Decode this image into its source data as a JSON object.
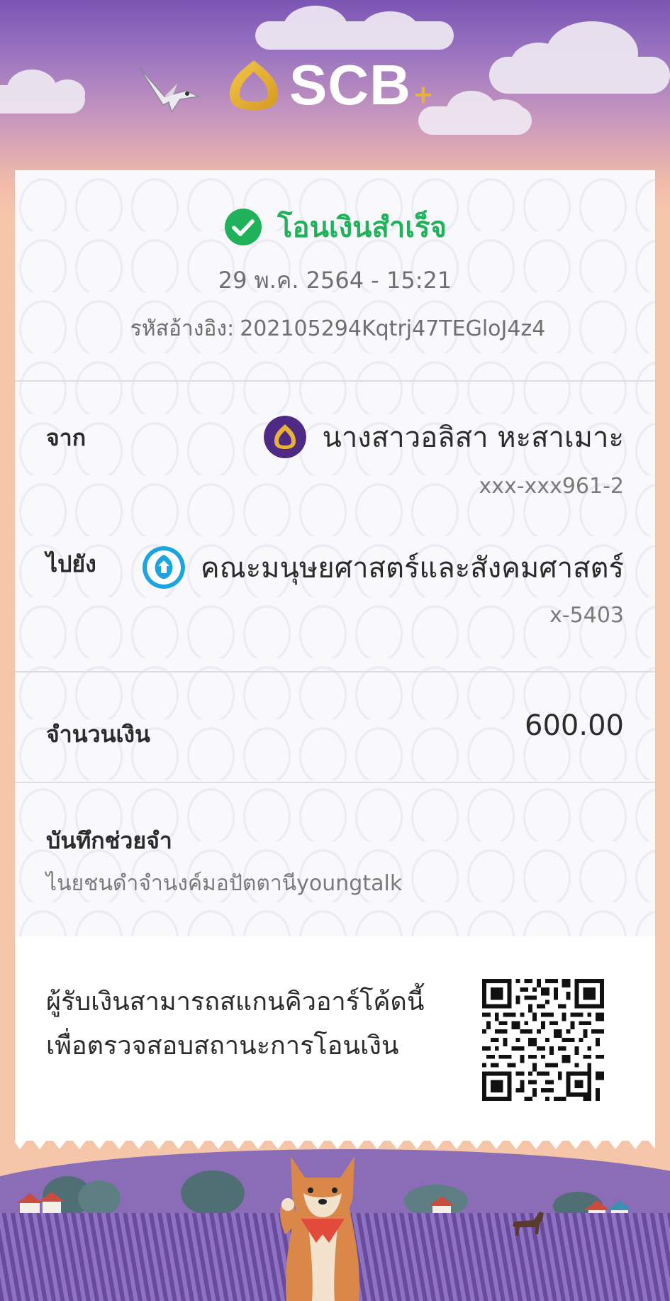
{
  "brand": {
    "name": "SCB",
    "plus": "+",
    "colors": {
      "purple": "#4e2a84",
      "gold": "#e6b23a",
      "success_green": "#1fb25a"
    }
  },
  "status": {
    "icon": "check-circle-icon",
    "text": "โอนเงินสำเร็จ"
  },
  "transaction": {
    "datetime": "29 พ.ค. 2564 - 15:21",
    "ref_label": "รหัสอ้างอิง:",
    "ref_value": "202105294Kqtrj47TEGloJ4z4"
  },
  "from": {
    "label": "จาก",
    "avatar_icon": "scb-bank-icon",
    "name": "นางสาวอลิสา หะสาเมาะ",
    "account": "xxx-xxx961-2"
  },
  "to": {
    "label": "ไปยัง",
    "avatar_icon": "ktb-bank-icon",
    "name": "คณะมนุษยศาสตร์และสังคมศาสตร์",
    "account": "x-5403"
  },
  "amount": {
    "label": "จำนวนเงิน",
    "value": "600.00"
  },
  "memo": {
    "label": "บันทึกช่วยจำ",
    "text": "ไนยชนดำจำนงค์มอปัตตานีyoungtalk"
  },
  "qr": {
    "line1": "ผู้รับเงินสามารถสแกนคิวอาร์โค้ดนี้",
    "line2": "เพื่อตรวจสอบสถานะการโอนเงิน",
    "icon": "qr-code-icon"
  }
}
